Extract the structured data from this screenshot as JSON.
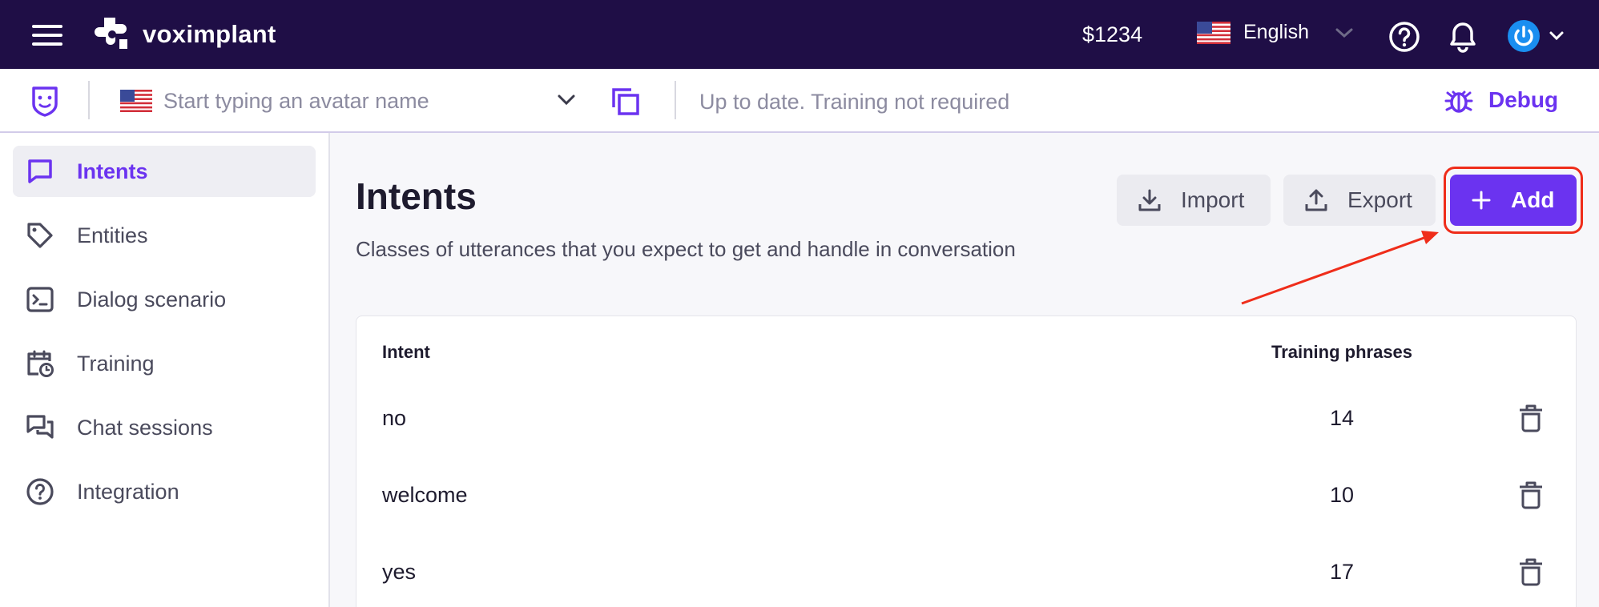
{
  "header": {
    "brand": "voximplant",
    "balance": "$1234",
    "language": "English",
    "icons": [
      "menu-icon",
      "help-icon",
      "bell-icon",
      "power-icon",
      "chevron-down-icon"
    ]
  },
  "subbar": {
    "avatar_placeholder": "Start typing an avatar name",
    "status": "Up to date. Training not required",
    "debug_label": "Debug"
  },
  "sidebar": {
    "items": [
      {
        "label": "Intents",
        "icon": "chat-bubble-icon",
        "active": true
      },
      {
        "label": "Entities",
        "icon": "tag-icon",
        "active": false
      },
      {
        "label": "Dialog scenario",
        "icon": "terminal-icon",
        "active": false
      },
      {
        "label": "Training",
        "icon": "calendar-clock-icon",
        "active": false
      },
      {
        "label": "Chat sessions",
        "icon": "chats-icon",
        "active": false
      },
      {
        "label": "Integration",
        "icon": "question-circle-icon",
        "active": false
      }
    ]
  },
  "main": {
    "title": "Intents",
    "subtitle": "Classes of utterances that you expect to get and handle in conversation",
    "import_label": "Import",
    "export_label": "Export",
    "add_label": "Add",
    "table": {
      "columns": [
        "Intent",
        "Training phrases"
      ],
      "rows": [
        {
          "name": "no",
          "count": "14"
        },
        {
          "name": "welcome",
          "count": "10"
        },
        {
          "name": "yes",
          "count": "17"
        }
      ]
    }
  },
  "colors": {
    "topbar": "#1f0e46",
    "accent": "#6b33f0",
    "annotation": "#ef2d1a"
  }
}
